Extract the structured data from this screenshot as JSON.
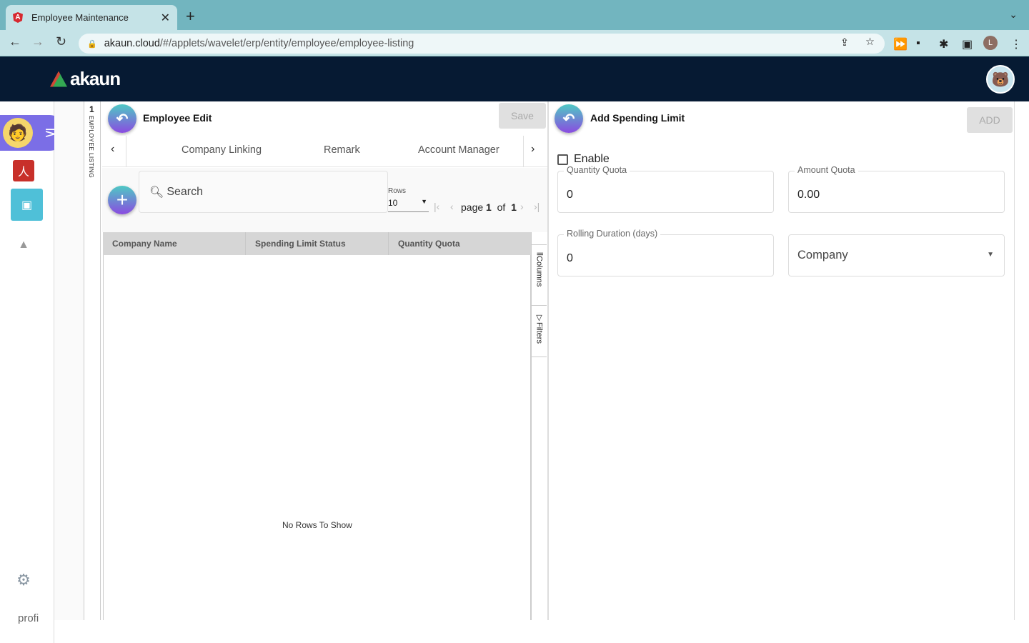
{
  "browser": {
    "tab_title": "Employee Maintenance",
    "url_host": "akaun.cloud",
    "url_path": "/#/applets/wavelet/erp/entity/employee/employee-listing",
    "profile_initial": "L"
  },
  "app": {
    "logo_text": "akaun"
  },
  "sidebar": {
    "vertical_label": "EMPLOYEE LISTING",
    "panel_count": "1",
    "broken_image_alt": "profi"
  },
  "employee_edit": {
    "title": "Employee Edit",
    "save_label": "Save",
    "tabs": [
      "Company Linking",
      "Remark",
      "Account Manager"
    ],
    "search_placeholder": "Search",
    "rows_label": "Rows",
    "rows_value": "10",
    "page_label": "page",
    "page_current": "1",
    "page_of": "of",
    "page_total": "1",
    "columns": [
      "Company Name",
      "Spending Limit Status",
      "Quantity Quota"
    ],
    "empty_text": "No Rows To Show",
    "side_columns": "Columns",
    "side_filters": "Filters"
  },
  "spending_limit": {
    "title": "Add Spending Limit",
    "add_label": "ADD",
    "enable_label": "Enable",
    "enable_checked": false,
    "quantity_quota_label": "Quantity Quota",
    "quantity_quota": "0",
    "amount_quota_label": "Amount Quota",
    "amount_quota": "0.00",
    "rolling_label": "Rolling Duration (days)",
    "rolling_value": "0",
    "company_placeholder": "Company"
  }
}
